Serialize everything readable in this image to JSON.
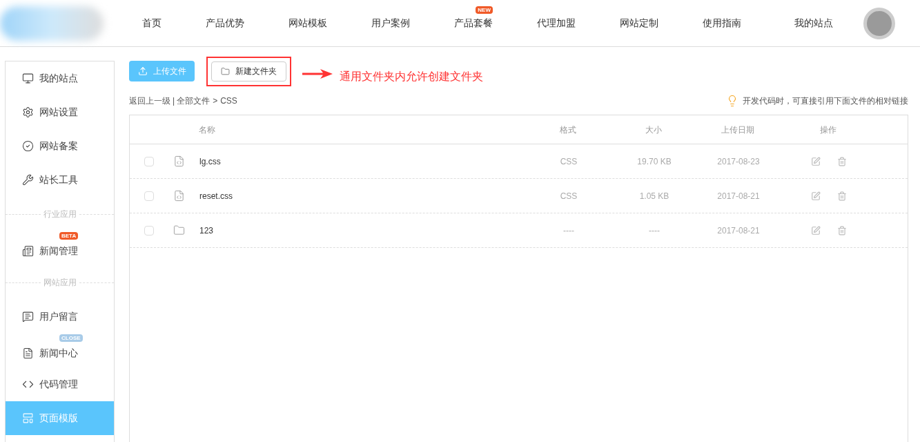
{
  "nav": {
    "items": [
      {
        "label": "首页"
      },
      {
        "label": "产品优势"
      },
      {
        "label": "网站模板"
      },
      {
        "label": "用户案例"
      },
      {
        "label": "产品套餐",
        "badge": "NEW"
      },
      {
        "label": "代理加盟"
      },
      {
        "label": "网站定制"
      },
      {
        "label": "使用指南"
      }
    ],
    "my_sites": "我的站点"
  },
  "sidebar": {
    "items": [
      {
        "kind": "item",
        "label": "我的站点",
        "selected": false
      },
      {
        "kind": "item",
        "label": "网站设置",
        "selected": false
      },
      {
        "kind": "item",
        "label": "网站备案",
        "selected": false
      },
      {
        "kind": "item",
        "label": "站长工具",
        "selected": false
      },
      {
        "kind": "section",
        "label": "行业应用"
      },
      {
        "kind": "item",
        "label": "新闻管理",
        "selected": false,
        "badge": "BETA",
        "color": "#f05a28"
      },
      {
        "kind": "section",
        "label": "网站应用"
      },
      {
        "kind": "item",
        "label": "用户留言",
        "selected": false
      },
      {
        "kind": "item",
        "label": "新闻中心",
        "selected": false,
        "badge": "CLOSE",
        "color": "#a8cbe8"
      },
      {
        "kind": "item",
        "label": "代码管理",
        "selected": false
      },
      {
        "kind": "item",
        "label": "页面模版",
        "selected": true
      }
    ]
  },
  "toolbar": {
    "upload": "上传文件",
    "new_folder": "新建文件夹",
    "annotation": "通用文件夹内允许创建文件夹"
  },
  "breadcrumb": {
    "back": "返回上一级",
    "separator": "|",
    "root": "全部文件",
    "arrow": ">",
    "current": "CSS"
  },
  "hint": "开发代码时，可直接引用下面文件的相对链接",
  "table": {
    "columns": [
      "名称",
      "格式",
      "大小",
      "上传日期",
      "操作"
    ],
    "rows": [
      {
        "kind": "css",
        "checked": false,
        "name": "lg.css",
        "format": "CSS",
        "size": "19.70 KB",
        "date": "2017-08-23"
      },
      {
        "kind": "css",
        "checked": false,
        "name": "reset.css",
        "format": "CSS",
        "size": "1.05 KB",
        "date": "2017-08-21"
      },
      {
        "kind": "folder",
        "checked": false,
        "name": "123",
        "format": "----",
        "size": "----",
        "date": "2017-08-21"
      }
    ]
  }
}
